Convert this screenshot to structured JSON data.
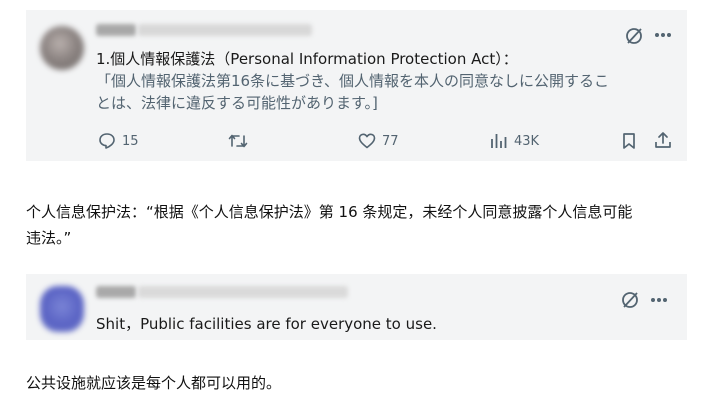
{
  "post1": {
    "title_line": "1.個人情報保護法（Personal Information Protection Act）：",
    "quote_line1": "「個人情報保護法第16条に基づき、個人情報を本人の同意なしに公開するこ",
    "quote_line2": "とは、法律に違反する可能性があります。]",
    "stats": {
      "replies": "15",
      "likes": "77",
      "views": "43K"
    }
  },
  "caption1_line1": "个人信息保护法：“根据《个人信息保护法》第 16 条规定，未经个人同意披露个人信息可能",
  "caption1_line2": "违法。”",
  "post2": {
    "text": "Shit，Public facilities are for everyone to use."
  },
  "caption2": "公共设施就应该是每个人都可以用的。",
  "colors": {
    "card_bg": "#f3f4f5",
    "icon_gray": "#536471",
    "text": "#0f1419"
  }
}
